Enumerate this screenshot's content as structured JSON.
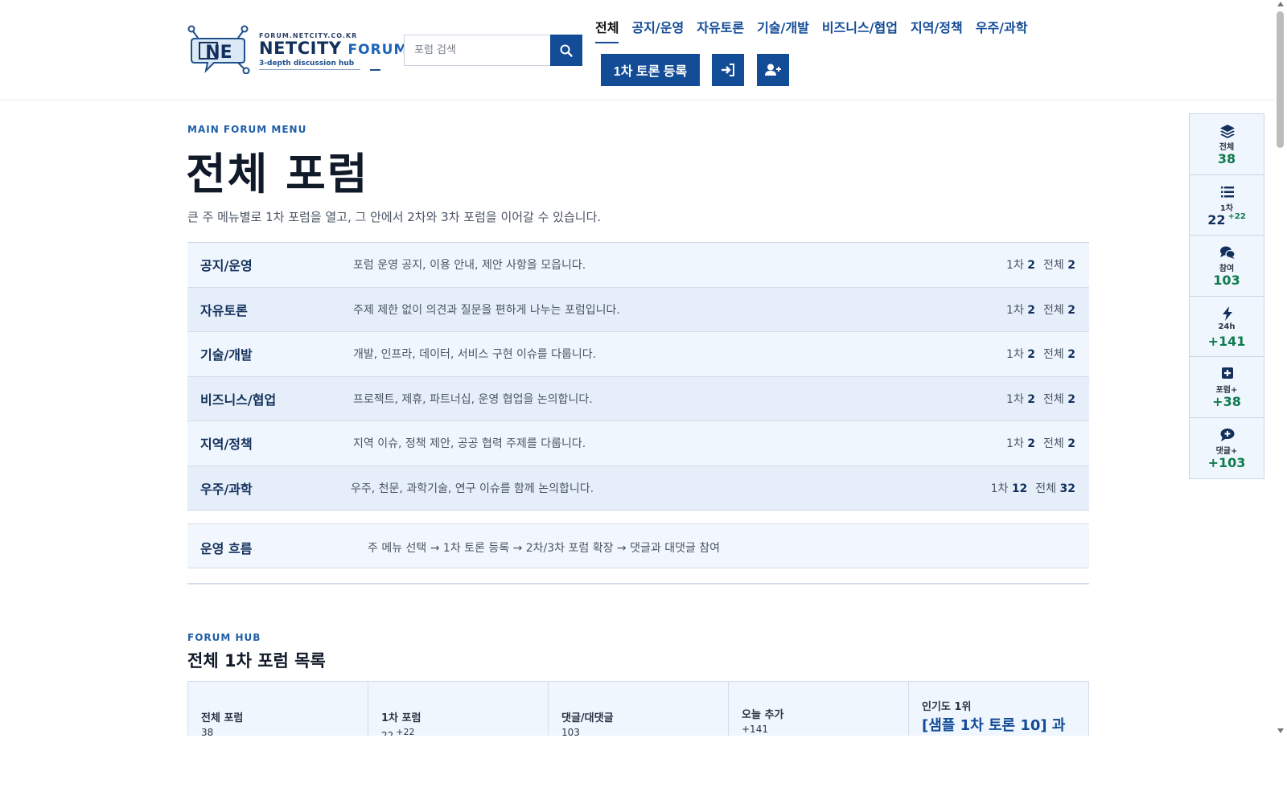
{
  "logo": {
    "domain": "FORUM.NETCITY.CO.KR",
    "brand": "NETCITY",
    "forum_word": "FORUM",
    "tagline": "3-depth discussion hub",
    "mark_text": "NE"
  },
  "search": {
    "placeholder": "포럼 검색",
    "icon": "search-icon"
  },
  "nav": {
    "items": [
      {
        "label": "전체",
        "active": true
      },
      {
        "label": "공지/운영",
        "active": false
      },
      {
        "label": "자유토론",
        "active": false
      },
      {
        "label": "기술/개발",
        "active": false
      },
      {
        "label": "비즈니스/협업",
        "active": false
      },
      {
        "label": "지역/정책",
        "active": false
      },
      {
        "label": "우주/과학",
        "active": false
      }
    ],
    "register_button": "1차 토론 등록",
    "login_icon": "sign-in-icon",
    "signup_icon": "user-plus-icon"
  },
  "main": {
    "eyebrow": "MAIN FORUM MENU",
    "title": "전체 포럼",
    "description": "큰 주 메뉴별로 1차 포럼을 열고, 그 안에서 2차와 3차 포럼을 이어갈 수 있습니다.",
    "stat_label_first": "1차",
    "stat_label_total": "전체",
    "categories": [
      {
        "name": "공지/운영",
        "desc": "포럼 운영 공지, 이용 안내, 제안 사항을 모읍니다.",
        "first": "2",
        "total": "2"
      },
      {
        "name": "자유토론",
        "desc": "주제 제한 없이 의견과 질문을 편하게 나누는 포럼입니다.",
        "first": "2",
        "total": "2"
      },
      {
        "name": "기술/개발",
        "desc": "개발, 인프라, 데이터, 서비스 구현 이슈를 다룹니다.",
        "first": "2",
        "total": "2"
      },
      {
        "name": "비즈니스/협업",
        "desc": "프로젝트, 제휴, 파트너십, 운영 협업을 논의합니다.",
        "first": "2",
        "total": "2"
      },
      {
        "name": "지역/정책",
        "desc": "지역 이슈, 정책 제안, 공공 협력 주제를 다룹니다.",
        "first": "2",
        "total": "2"
      },
      {
        "name": "우주/과학",
        "desc": "우주, 천문, 과학기술, 연구 이슈를 함께 논의합니다.",
        "first": "12",
        "total": "32"
      }
    ],
    "flow": {
      "label": "운영 흐름",
      "text": "주 메뉴 선택 → 1차 토론 등록 → 2차/3차 포럼 확장 → 댓글과 대댓글 참여"
    }
  },
  "hub": {
    "eyebrow": "FORUM HUB",
    "title": "전체 1차 포럼 목록",
    "cards": [
      {
        "label": "전체 포럼",
        "value": "38",
        "delta": ""
      },
      {
        "label": "1차 포럼",
        "value": "22",
        "delta": "+22"
      },
      {
        "label": "댓글/대댓글",
        "value": "103",
        "delta": ""
      },
      {
        "label": "오늘 추가",
        "value": "+141",
        "delta": ""
      }
    ],
    "top": {
      "label": "인기도 1위",
      "title": "[샘플 1차 토론 10] 과"
    }
  },
  "rail": [
    {
      "icon": "layers-icon",
      "label": "전체",
      "value": "38",
      "delta": ""
    },
    {
      "icon": "list-icon",
      "label": "1차",
      "value": "22",
      "delta": "+22"
    },
    {
      "icon": "comments-icon",
      "label": "참여",
      "value": "103",
      "delta": ""
    },
    {
      "icon": "bolt-icon",
      "label": "24h",
      "value": "+141",
      "delta": ""
    },
    {
      "icon": "plus-square-icon",
      "label": "포럼+",
      "value": "+38",
      "delta": ""
    },
    {
      "icon": "comment-plus-icon",
      "label": "댓글+",
      "value": "+103",
      "delta": ""
    }
  ],
  "colors": {
    "primary": "#124b96",
    "heading": "#13305c",
    "accent_green": "#0f7a4e",
    "row_light": "#f0f6fd",
    "row_alt": "#e6eff9"
  }
}
